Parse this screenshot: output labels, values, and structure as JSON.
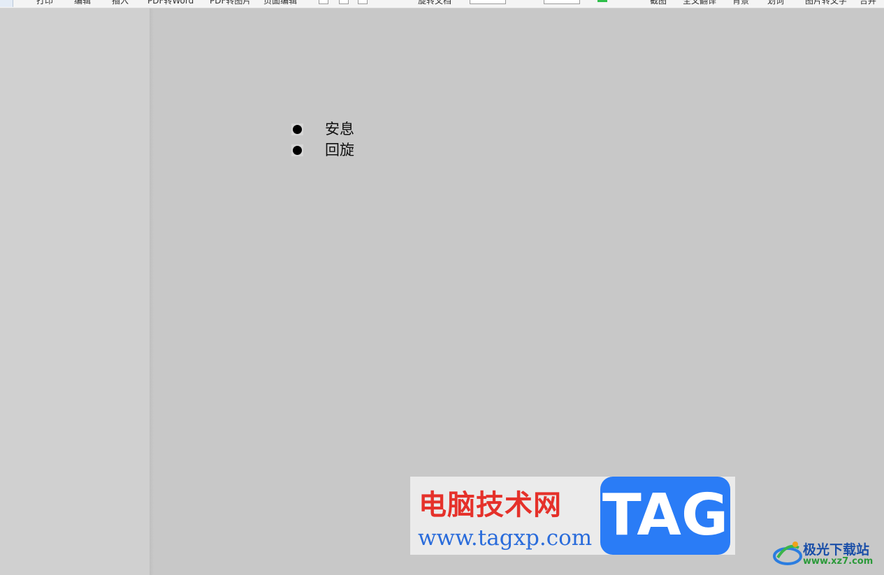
{
  "toolbar": {
    "items": [
      "打印",
      "编辑",
      "插入",
      "PDF转Word",
      "PDF转图片",
      "页面编辑",
      "旋转文档",
      "截图",
      "全文翻译",
      "背景",
      "划词",
      "图片转文字",
      "合并"
    ]
  },
  "document": {
    "list": [
      "安息",
      "回旋"
    ]
  },
  "watermark": {
    "title": "电脑技术网",
    "url": "www.tagxp.com",
    "tag": "TAG"
  },
  "site_logo": {
    "name": "极光下载站",
    "url": "www.xz7.com"
  }
}
